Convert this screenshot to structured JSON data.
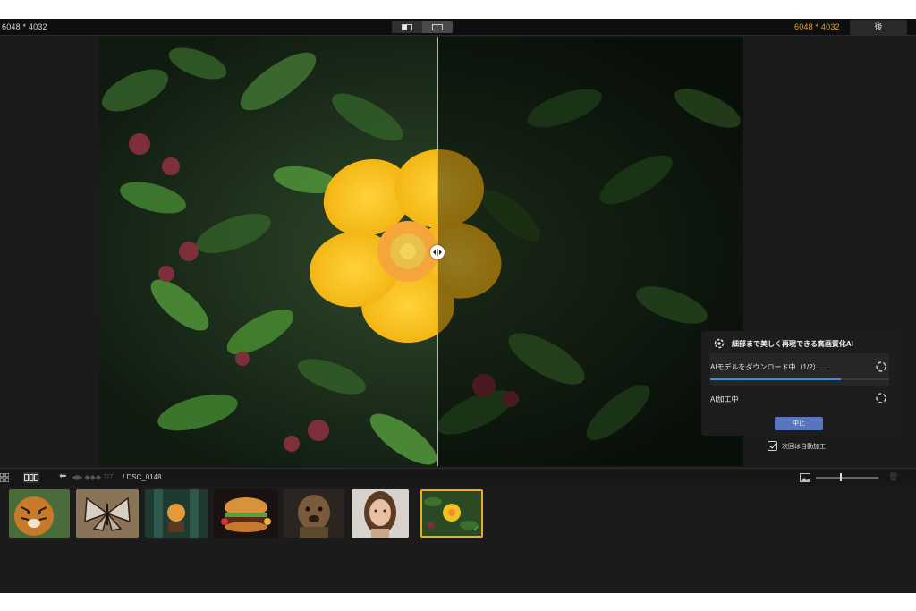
{
  "topbar": {
    "dimensions_before": "6048 * 4032",
    "dimensions_after": "6048 * 4032",
    "after_label": "後",
    "view_modes": [
      "single-view",
      "split-view"
    ],
    "active_view": "split-view"
  },
  "preview": {
    "subject": "yellow-flower-photo"
  },
  "ai_panel": {
    "title": "細部まで美しく再現できる高画質化AI",
    "download_label": "AIモデルをダウンロード中（1/2）...",
    "download_progress": 0.73,
    "processing_label": "AI加工中",
    "stop_label": "中止",
    "auto_label": "次回は自動加工",
    "auto_checked": true
  },
  "bottombar": {
    "path_dim": "◀▶ ◆◆◆ 7/7",
    "path_file": "/ DSC_0148",
    "zoom_level": 0.4
  },
  "filmstrip": {
    "items": [
      {
        "name": "tiger-thumbnail"
      },
      {
        "name": "butterfly-thumbnail"
      },
      {
        "name": "forest-lantern-thumbnail"
      },
      {
        "name": "burger-thumbnail"
      },
      {
        "name": "dog-portrait-thumbnail"
      },
      {
        "name": "woman-portrait-thumbnail"
      },
      {
        "name": "yellow-flower-thumbnail",
        "selected": true
      }
    ]
  },
  "colors": {
    "accent_orange": "#f0a21a",
    "selection_yellow": "#e8b11c",
    "progress_blue": "#3f8de8",
    "button_blue": "#5876c0"
  }
}
